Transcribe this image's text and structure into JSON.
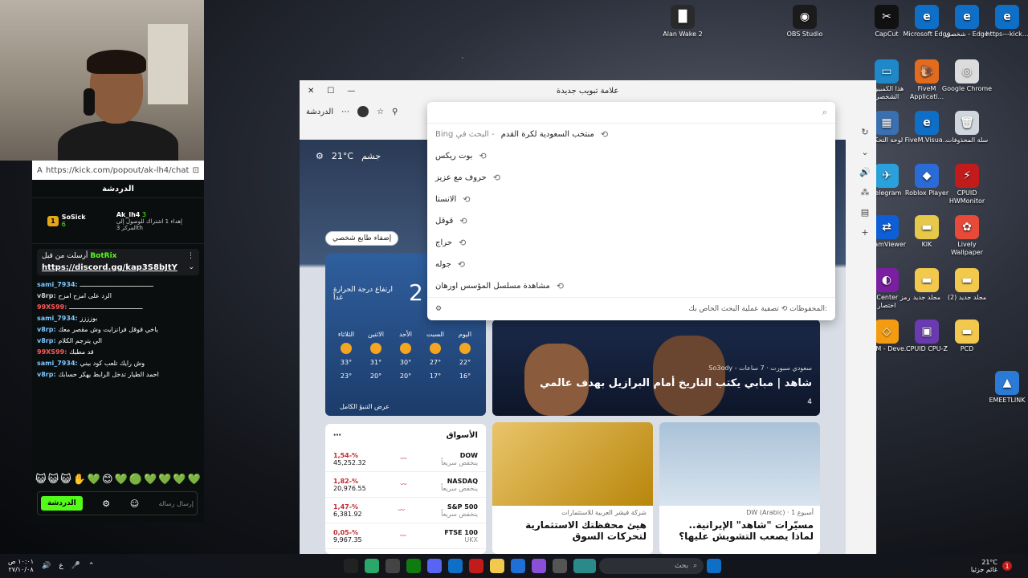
{
  "desktop": {
    "icons": [
      {
        "label": "Alan Wake 2",
        "color": "#2a2a2a",
        "glyph": "▐▌"
      },
      {
        "label": "OBS Studio",
        "color": "#1b1b1b",
        "glyph": "◉"
      },
      {
        "label": "CapCut",
        "color": "#111111",
        "glyph": "✂"
      },
      {
        "label": "Microsoft Edge",
        "color": "#0f6fc6",
        "glyph": "e"
      },
      {
        "label": "شخصي - Edge",
        "color": "#0f6fc6",
        "glyph": "e"
      },
      {
        "label": "https---kick...",
        "color": "#0f6fc6",
        "glyph": "e"
      },
      {
        "label": "هذا الكمبيوتر الشخصي",
        "color": "#1e88c8",
        "glyph": "▭"
      },
      {
        "label": "FiveM Applicati...",
        "color": "#e36b1e",
        "glyph": "🐌"
      },
      {
        "label": "Google Chrome",
        "color": "#dcdcdc",
        "glyph": "◎"
      },
      {
        "label": "لوحة التحكم",
        "color": "#3a6fb0",
        "glyph": "▦"
      },
      {
        "label": "FiveM.Visua...",
        "color": "#0f6fc6",
        "glyph": "e"
      },
      {
        "label": "سلة المحذوفات",
        "color": "#cfd6de",
        "glyph": "🗑"
      },
      {
        "label": "Telegram",
        "color": "#2aa1da",
        "glyph": "✈"
      },
      {
        "label": "Roblox Player",
        "color": "#2a6bd6",
        "glyph": "◆"
      },
      {
        "label": "CPUID HWMonitor",
        "color": "#c21b1b",
        "glyph": "⚡"
      },
      {
        "label": "TeamViewer",
        "color": "#0e5fd6",
        "glyph": "⇄"
      },
      {
        "label": "KIK",
        "color": "#e6c84a",
        "glyph": "▬"
      },
      {
        "label": "Lively Wallpaper",
        "color": "#e84a3a",
        "glyph": "✿"
      },
      {
        "label": "MSI Center رمز اختصار",
        "color": "#7b1fa2",
        "glyph": "◐"
      },
      {
        "label": "مجلد جديد",
        "color": "#f2c94c",
        "glyph": "▬"
      },
      {
        "label": "مجلد جديد (2)",
        "color": "#f2c94c",
        "glyph": "▬"
      },
      {
        "label": "FiveM - Deve...",
        "color": "#f39c12",
        "glyph": "◇"
      },
      {
        "label": "CPUID CPU-Z",
        "color": "#6a3bb0",
        "glyph": "▣"
      },
      {
        "label": "PCD",
        "color": "#f2c94c",
        "glyph": "▬"
      },
      {
        "label": "EMEETLINK",
        "color": "#2a7ad6",
        "glyph": "▲"
      }
    ]
  },
  "kick": {
    "url": "https://kick.com/popout/ak-lh4/chat",
    "header": "الدردشة",
    "leaderboard": [
      {
        "rank": "1",
        "name": "SoSick",
        "count": "6"
      },
      {
        "rank": "3",
        "name": "Ak_lh4",
        "note": "إهداء 1 اشتراك للوصول إلى المركز 3th"
      }
    ],
    "pinned": {
      "by": "أرسلت من قبل",
      "user": "BotRix",
      "link": "https://discord.gg/kap3S8bJtY"
    },
    "messages": [
      {
        "user": "sami_7934:",
        "text": "ـــــــــــــــــــــــــــــــــــــــ",
        "color": "#7ec8ff"
      },
      {
        "user": "v8rp:",
        "text": "الرد على امزح امزح",
        "color": "#cccccc"
      },
      {
        "user": "99XS99:",
        "text": "ـــــــــــــــــــــــــــــــــــــــ",
        "color": "#ff5a5a"
      },
      {
        "user": "sami_7934:",
        "text": "بوزززز",
        "color": "#7ec8ff"
      },
      {
        "user": "v8rp:",
        "text": "ياخي قوقل فرانزايت وش مقصر معك",
        "color": "#7ec8ff"
      },
      {
        "user": "v8rp:",
        "text": "الي يترجم الكلام",
        "color": "#7ec8ff"
      },
      {
        "user": "99XS99:",
        "text": "قد مطبك",
        "color": "#ff5a5a"
      },
      {
        "user": "sami_7934:",
        "text": "وش رايك تلعب كود بيني",
        "color": "#7ec8ff"
      },
      {
        "user": "v8rp:",
        "text": "احمد الطيار تدخل الرابط يهكر حسابك",
        "color": "#7ec8ff"
      }
    ],
    "emotes": "😺😺😺✋💚😊💚🟢💚💚💚💚",
    "send_label": "الدردشة",
    "input_placeholder": "إرسال رسالة"
  },
  "browser": {
    "tab_title": "علامة تبويب جديدة",
    "chat_label": "الدردشة",
    "search": {
      "items": [
        {
          "text": "منتخب السعودية لكرة القدم",
          "suffix": "البحث في Bing"
        },
        {
          "text": "بوت ريكس"
        },
        {
          "text": "حروف مع عزيز"
        },
        {
          "text": "الانستا"
        },
        {
          "text": "قوقل"
        },
        {
          "text": "حراج"
        },
        {
          "text": "جوله"
        },
        {
          "text": "مشاهدة مسلسل المؤسس اورهان"
        }
      ],
      "footer_label": "تصفية عملية البحث الخاص بك:",
      "saved_label": "المحفوظات"
    },
    "weather": {
      "location": "جشم",
      "temp_top": "21°C",
      "big_temp": "2",
      "tomorrow": "ارتفاع درجة الحرارة غداً",
      "days": [
        "اليوم",
        "السبت",
        "الأحد",
        "الاثنين",
        "الثلاثاء"
      ],
      "highs": [
        "22°",
        "27°",
        "30°",
        "31°",
        "33°"
      ],
      "lows": [
        "16°",
        "17°",
        "20°",
        "20°",
        "23°"
      ],
      "full_forecast": "عرض التنبؤ الكامل"
    },
    "personalize": "إضفاء طابع شخصي",
    "news_main": {
      "source": "So3ody - سعودي سبورت · 7 ساعات",
      "title": "شاهد | مبابي يكتب التاريخ أمام البرازيل بهدف عالمي",
      "likes": "4"
    },
    "markets": {
      "title": "الأسواق",
      "rows": [
        {
          "name": "DOW",
          "sub": "ينخفض سريعاً",
          "pct": "1,54-%",
          "val": "45,252.32"
        },
        {
          "name": "NASDAQ",
          "sub": "ينخفض سريعاً",
          "pct": "1,82-%",
          "val": "20,976.55"
        },
        {
          "name": "S&P 500",
          "sub": "ينخفض سريعاً",
          "pct": "1,47-%",
          "val": "6,381.92"
        },
        {
          "name": "FTSE 100",
          "sub": "UKX",
          "pct": "0,05-%",
          "val": "9,967.35"
        }
      ]
    },
    "news_gold": {
      "source": "شركة فيشر العربية للاستثمارات",
      "title": "هيئ محفظتك الاستثمارية لتحركات السوق"
    },
    "news_drone": {
      "source": "DW (Arabic) · 1 أسبوع",
      "title": "مسيّرات \"شاهد\" الإيرانية.. لماذا يصعب التشويش عليها؟"
    }
  },
  "taskbar": {
    "search_placeholder": "بحث",
    "clock_time": "١٠:٠١ ص",
    "clock_date": "٢٧/١٠/٠٨",
    "weather_temp": "21°C",
    "weather_desc": "غائم جزئيا",
    "lang": "ع",
    "notif_count": "1"
  }
}
